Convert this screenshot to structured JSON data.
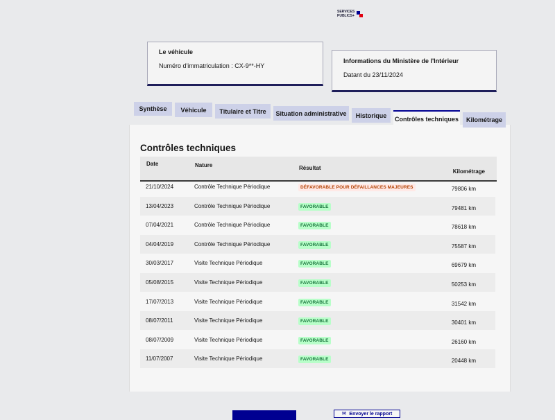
{
  "brand": {
    "line1": "SERVICES",
    "line2": "PUBLICS+"
  },
  "vehicle_card": {
    "title": "Le véhicule",
    "plate_label": "Numéro d'immatriculation : CX-9**-HY"
  },
  "ministry_card": {
    "title": "Informations du Ministère de l'Intérieur",
    "date_label": "Datant du 23/11/2024"
  },
  "tabs": [
    {
      "label": "Synthèse"
    },
    {
      "label": "Véhicule"
    },
    {
      "label": "Titulaire et Titre"
    },
    {
      "label": "Situation administrative"
    },
    {
      "label": "Historique"
    },
    {
      "label": "Contrôles techniques"
    },
    {
      "label": "Kilométrage"
    }
  ],
  "active_tab": "Contrôles techniques",
  "section_title": "Contrôles techniques",
  "table": {
    "headers": {
      "date": "Date",
      "nature": "Nature",
      "result": "Résultat",
      "km": "Kilométrage"
    },
    "rows": [
      {
        "date": "21/10/2024",
        "nature": "Contrôle Technique Périodique",
        "result": "DÉFAVORABLE POUR DÉFAILLANCES MAJEURES",
        "status": "ko",
        "km": "79806 km"
      },
      {
        "date": "13/04/2023",
        "nature": "Contrôle Technique Périodique",
        "result": "FAVORABLE",
        "status": "ok",
        "km": "79481 km"
      },
      {
        "date": "07/04/2021",
        "nature": "Contrôle Technique Périodique",
        "result": "FAVORABLE",
        "status": "ok",
        "km": "78618 km"
      },
      {
        "date": "04/04/2019",
        "nature": "Contrôle Technique Périodique",
        "result": "FAVORABLE",
        "status": "ok",
        "km": "75587 km"
      },
      {
        "date": "30/03/2017",
        "nature": "Visite Technique Périodique",
        "result": "FAVORABLE",
        "status": "ok",
        "km": "69679 km"
      },
      {
        "date": "05/08/2015",
        "nature": "Visite Technique Périodique",
        "result": "FAVORABLE",
        "status": "ok",
        "km": "50253 km"
      },
      {
        "date": "17/07/2013",
        "nature": "Visite Technique Périodique",
        "result": "FAVORABLE",
        "status": "ok",
        "km": "31542 km"
      },
      {
        "date": "08/07/2011",
        "nature": "Visite Technique Périodique",
        "result": "FAVORABLE",
        "status": "ok",
        "km": "30401 km"
      },
      {
        "date": "08/07/2009",
        "nature": "Visite Technique Périodique",
        "result": "FAVORABLE",
        "status": "ok",
        "km": "26160 km"
      },
      {
        "date": "11/07/2007",
        "nature": "Visite Technique Périodique",
        "result": "FAVORABLE",
        "status": "ok",
        "km": "20448 km"
      }
    ]
  },
  "actions": {
    "primary_label": "",
    "secondary_label": "Envoyer le rapport",
    "secondary_icon": "mail-icon"
  },
  "colors": {
    "primary": "#000091",
    "tab_bg": "#cdd1e8",
    "ok_bg": "#b8fec9",
    "ok_fg": "#18753c",
    "ko_bg": "#ffe9e6",
    "ko_fg": "#b34000"
  }
}
